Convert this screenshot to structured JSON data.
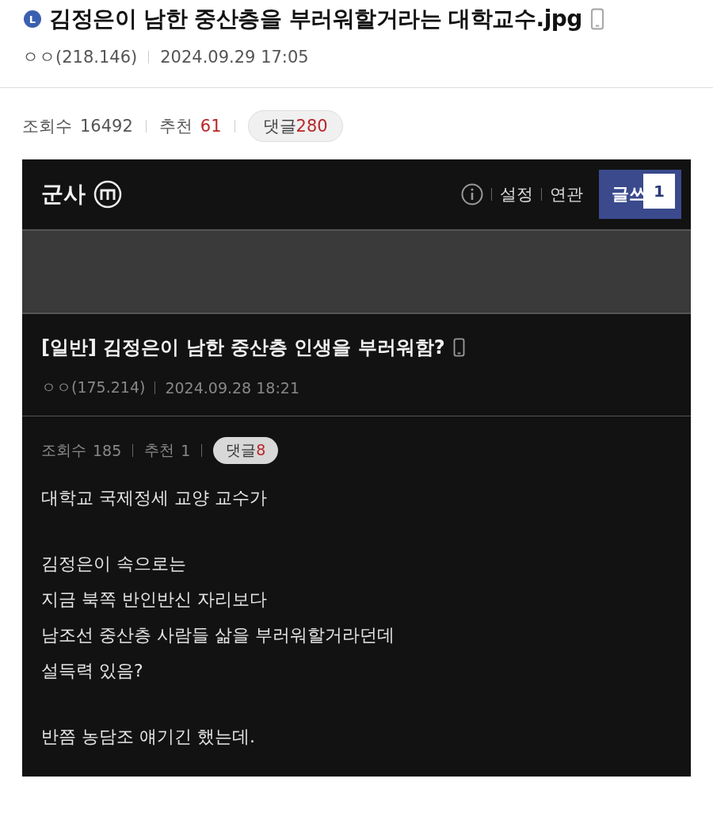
{
  "post": {
    "badge": "L",
    "title": "김정은이 남한 중산층을 부러워할거라는 대학교수.jpg",
    "mobile": true,
    "author": "ㅇㅇ(218.146)",
    "date": "2024.09.29 17:05"
  },
  "stats": {
    "views_label": "조회수",
    "views": "16492",
    "recommend_label": "추천",
    "recommend": "61",
    "comments_label": "댓글",
    "comments": "280"
  },
  "screenshot": {
    "logo": "군사",
    "nav": [
      "설정",
      "연관"
    ],
    "write_button": "글쓰",
    "write_badge": "1",
    "post": {
      "title": "[일반] 김정은이 남한 중산층 인생을 부러워함?",
      "mobile": true,
      "author": "ㅇㅇ(175.214)",
      "date": "2024.09.28 18:21"
    },
    "stats": {
      "views_label": "조회수",
      "views": "185",
      "recommend_label": "추천",
      "recommend": "1",
      "comments_label": "댓글",
      "comments": "8"
    },
    "paragraphs": [
      "대학교 국제정세 교양 교수가",
      "김정은이 속으로는\n지금 북쪽 반인반신 자리보다\n남조선 중산층 사람들 삶을 부러워할거라던데\n설득력 있음?",
      "반쯤 농담조 얘기긴 했는데."
    ]
  }
}
